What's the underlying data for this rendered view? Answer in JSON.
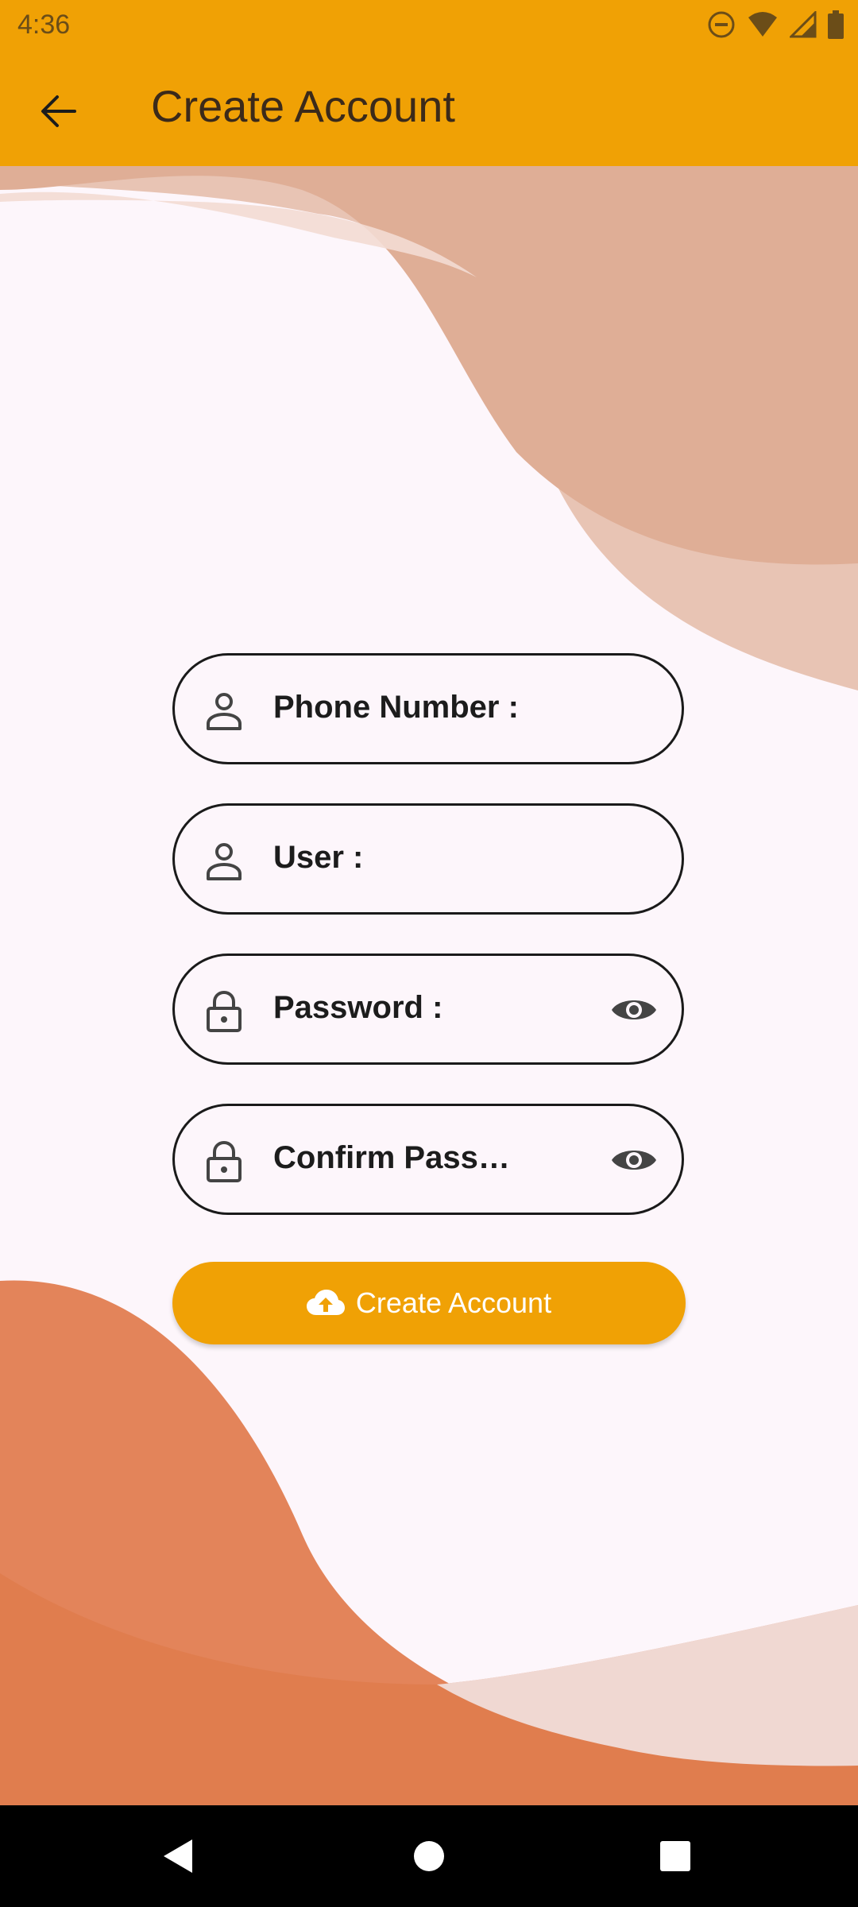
{
  "status_bar": {
    "time": "4:36",
    "icons": [
      "do-not-disturb-icon",
      "wifi-icon",
      "signal-icon",
      "battery-icon"
    ]
  },
  "app_bar": {
    "title": "Create Account",
    "back_icon": "arrow-left-icon"
  },
  "form": {
    "fields": [
      {
        "label": "Phone Number :",
        "icon": "person-icon",
        "has_visibility_toggle": false
      },
      {
        "label": "User :",
        "icon": "person-icon",
        "has_visibility_toggle": false
      },
      {
        "label": "Password :",
        "icon": "lock-icon",
        "has_visibility_toggle": true
      },
      {
        "label": "Confirm Pass…",
        "icon": "lock-icon",
        "has_visibility_toggle": true
      }
    ],
    "submit": {
      "label": "Create Account",
      "icon": "cloud-upload-icon"
    }
  },
  "nav_bar": {
    "buttons": [
      "back-triangle-icon",
      "home-circle-icon",
      "recents-square-icon"
    ]
  },
  "colors": {
    "accent": "#f0a105",
    "background": "#fdf6fb",
    "wave_light": "#dfae96",
    "wave_dark": "#df7845"
  }
}
